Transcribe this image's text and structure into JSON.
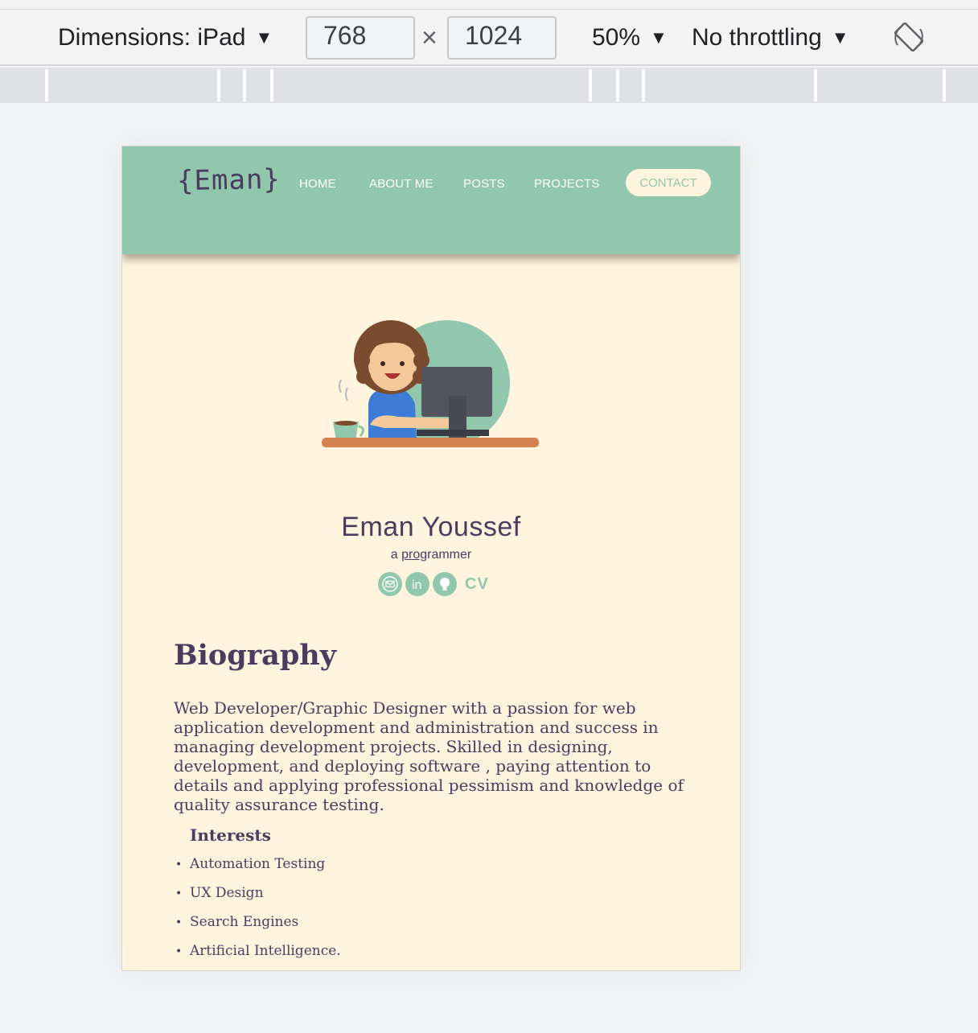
{
  "devtools": {
    "dimensions_label": "Dimensions: iPad",
    "width": "768",
    "height": "1024",
    "times": "×",
    "zoom": "50%",
    "throttling": "No throttling",
    "dropdown_glyph": "▼",
    "rotate_icon": "rotate-icon"
  },
  "site": {
    "logo": "{Eman}",
    "nav": {
      "home": "HOME",
      "about": "ABOUT ME",
      "posts": "POSTS",
      "projects": "PROJECTS",
      "contact": "CONTACT"
    },
    "profile": {
      "name": "Eman Youssef",
      "tagline_prefix": "a ",
      "tagline_underlined": "prog",
      "tagline_rest": "rammer",
      "social": [
        "mail-icon",
        "linkedin-icon",
        "github-icon"
      ],
      "cv": "CV"
    },
    "biography": {
      "title": "Biography",
      "text": "Web Developer/Graphic Designer with a passion for web application development and administration and success in managing development projects. Skilled in designing, development, and deploying software , paying attention to details and applying professional pessimism and knowledge of quality assurance testing."
    },
    "interests": {
      "title": "Interests",
      "items": [
        "Automation Testing",
        "UX Design",
        "Search Engines",
        "Artificial Intelligence."
      ]
    }
  },
  "colors": {
    "nav_bg": "#91c7ad",
    "page_bg": "#fff5de",
    "text": "#4b3b5f"
  }
}
